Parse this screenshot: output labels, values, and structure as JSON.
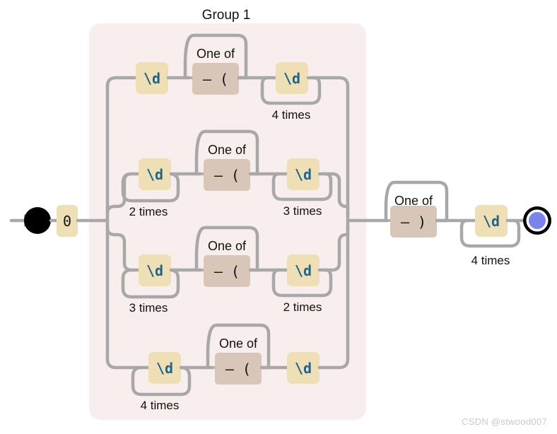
{
  "diagram": {
    "type": "regex-railroad",
    "title": "Group 1",
    "start_node": "start-circle",
    "end_node": "end-circle",
    "watermark": "CSDN @stwood007",
    "colors": {
      "group_background": "#f8eeee",
      "track": "#a8a8a8",
      "literal_node": "#eedfb6",
      "charclass_node": "#d8c7b8",
      "escape_text": "#236389",
      "literal_text": "#111111",
      "end_inner": "#7b84e8",
      "start_fill": "#000000"
    }
  },
  "prefix": {
    "literal": "0"
  },
  "group": {
    "label": "Group 1",
    "branches": [
      {
        "id": "branch-1",
        "items": [
          {
            "kind": "escape",
            "text": "\\d",
            "repeat": null
          },
          {
            "kind": "oneof",
            "label": "One of",
            "text": "–  (",
            "repeat": null
          },
          {
            "kind": "escape",
            "text": "\\d",
            "repeat": "4 times"
          }
        ]
      },
      {
        "id": "branch-2",
        "items": [
          {
            "kind": "escape",
            "text": "\\d",
            "repeat": "2 times"
          },
          {
            "kind": "oneof",
            "label": "One of",
            "text": "–  (",
            "repeat": null
          },
          {
            "kind": "escape",
            "text": "\\d",
            "repeat": "3 times"
          }
        ]
      },
      {
        "id": "branch-3",
        "items": [
          {
            "kind": "escape",
            "text": "\\d",
            "repeat": "3 times"
          },
          {
            "kind": "oneof",
            "label": "One of",
            "text": "–  (",
            "repeat": null
          },
          {
            "kind": "escape",
            "text": "\\d",
            "repeat": "2 times"
          }
        ]
      },
      {
        "id": "branch-4",
        "items": [
          {
            "kind": "escape",
            "text": "\\d",
            "repeat": "4 times"
          },
          {
            "kind": "oneof",
            "label": "One of",
            "text": "–  (",
            "repeat": null
          },
          {
            "kind": "escape",
            "text": "\\d",
            "repeat": null
          }
        ]
      }
    ]
  },
  "suffix": {
    "items": [
      {
        "kind": "oneof",
        "label": "One of",
        "text": "–  )",
        "repeat": null
      },
      {
        "kind": "escape",
        "text": "\\d",
        "repeat": "4 times"
      }
    ]
  },
  "labels": {
    "group_title": "Group 1",
    "one_of": "One of",
    "rep_2": "2 times",
    "rep_3": "3 times",
    "rep_4": "4 times",
    "escape_digit": "\\d",
    "literal_zero": "0",
    "charclass_open": "–  (",
    "charclass_close": "–  )"
  }
}
